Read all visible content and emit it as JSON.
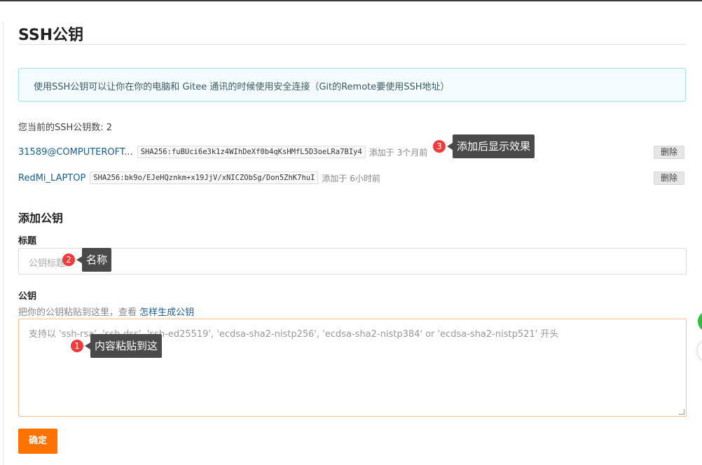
{
  "page": {
    "title": "SSH公钥",
    "info": "使用SSH公钥可以让你在你的电脑和 Gitee 通讯的时候使用安全连接（Git的Remote要使用SSH地址）",
    "count_text": "您当前的SSH公钥数: 2"
  },
  "keys": [
    {
      "name": "31589@COMPUTEROFT...",
      "fingerprint": "SHA256:fuBUci6e3k1z4WIhDeXf0b4qKsHMfL5D3oeLRa7BIy4",
      "added": "添加于 3个月前",
      "delete_label": "删除"
    },
    {
      "name": "RedMi_LAPTOP",
      "fingerprint": "SHA256:bk9o/EJeHQznkm+x19JjV/xNICZObSg/Don5ZhK7huI",
      "added": "添加于 6小时前",
      "delete_label": "删除"
    }
  ],
  "add_key": {
    "section_title": "添加公钥",
    "title_label": "标题",
    "title_placeholder": "公钥标题",
    "key_label": "公钥",
    "hint_prefix": "把你的公钥粘贴到这里，查看",
    "hint_link": "怎样生成公钥",
    "key_placeholder": "支持以 'ssh-rsa', 'ssh-dss', 'ssh-ed25519', 'ecdsa-sha2-nistp256', 'ecdsa-sha2-nistp384' or 'ecdsa-sha2-nistp521' 开头",
    "confirm_label": "确定"
  },
  "annotations": [
    {
      "number": "1",
      "text": "内容粘贴到这"
    },
    {
      "number": "2",
      "text": "名称"
    },
    {
      "number": "3",
      "text": "添加后显示效果"
    }
  ],
  "colors": {
    "accent": "#fe7300",
    "link": "#1a5d8c",
    "badge": "#ef3b3b",
    "info_bg": "#f3fbfc"
  }
}
